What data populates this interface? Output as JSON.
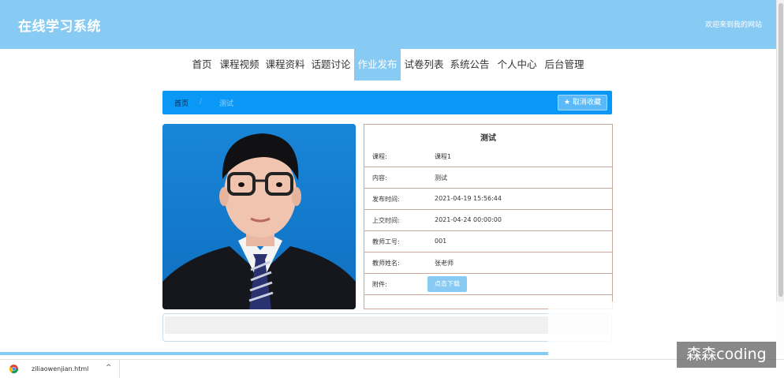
{
  "header": {
    "site_title": "在线学习系统",
    "welcome_text": "欢迎来到我的网站"
  },
  "nav": {
    "items": [
      {
        "label": "首页"
      },
      {
        "label": "课程视频"
      },
      {
        "label": "课程资料"
      },
      {
        "label": "话题讨论"
      },
      {
        "label": "作业发布",
        "active": true
      },
      {
        "label": "试卷列表"
      },
      {
        "label": "系统公告"
      },
      {
        "label": "个人中心"
      },
      {
        "label": "后台管理"
      }
    ]
  },
  "breadcrumb": {
    "home": "首页",
    "separator": "/",
    "current": "测试"
  },
  "favorite": {
    "icon": "star-icon",
    "label": "取消收藏"
  },
  "detail": {
    "title": "测试",
    "rows": [
      {
        "label": "课程:",
        "value": "课程1"
      },
      {
        "label": "内容:",
        "value": "测试"
      },
      {
        "label": "发布时间:",
        "value": "2021-04-19 15:56:44"
      },
      {
        "label": "上交时间:",
        "value": "2021-04-24 00:00:00"
      },
      {
        "label": "教师工号:",
        "value": "001"
      },
      {
        "label": "教师姓名:",
        "value": "张老师"
      },
      {
        "label": "附件:",
        "button": "点击下载"
      }
    ]
  },
  "download_bar": {
    "file_name": "ziliaowenjian.html",
    "icon": "chrome-icon"
  },
  "watermark": "森森coding",
  "colors": {
    "header": "#87cbf5",
    "breadcrumb": "#0a97f5",
    "accent": "#87cbf5",
    "panel_border": "#c8a99c"
  }
}
